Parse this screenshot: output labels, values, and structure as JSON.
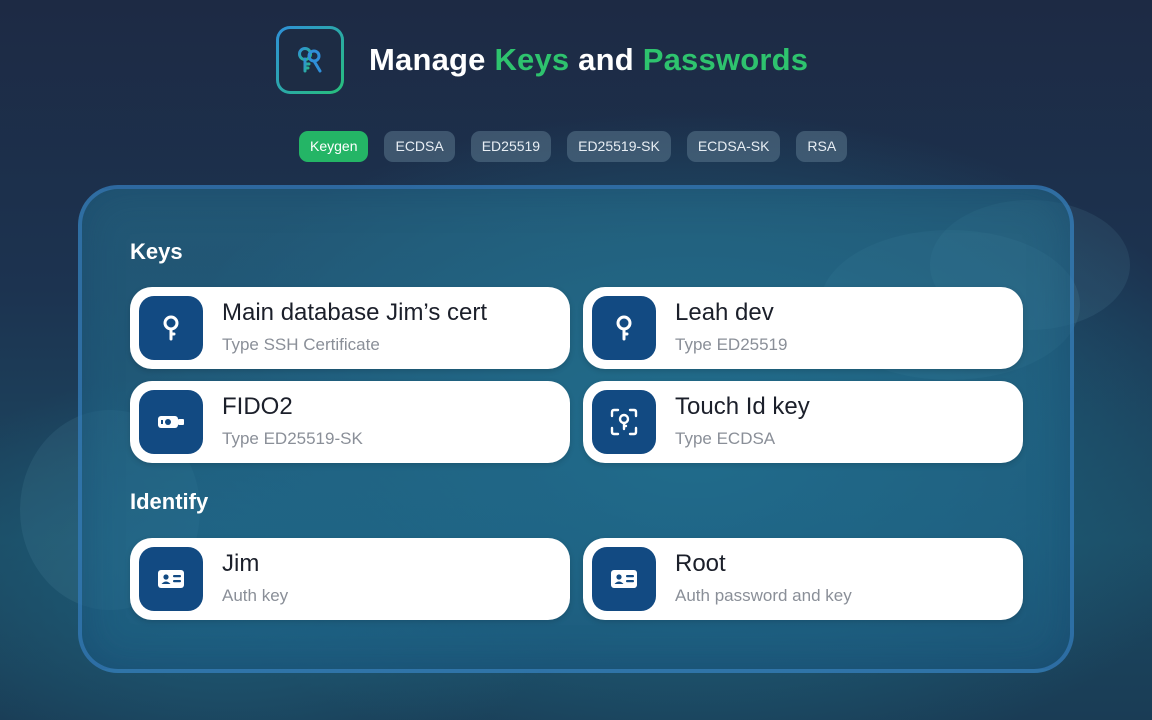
{
  "header": {
    "title_part1": "Manage ",
    "title_part2": "Keys",
    "title_part3": " and ",
    "title_part4": "Passwords",
    "logo_icon": "keys-logo-icon"
  },
  "tabs": [
    {
      "label": "Keygen",
      "active": true
    },
    {
      "label": "ECDSA",
      "active": false
    },
    {
      "label": "ED25519",
      "active": false
    },
    {
      "label": "ED25519-SK",
      "active": false
    },
    {
      "label": "ECDSA-SK",
      "active": false
    },
    {
      "label": "RSA",
      "active": false
    }
  ],
  "keys": {
    "title": "Keys",
    "items": [
      {
        "name": "Main database Jim’s cert",
        "type": "Type SSH Certificate",
        "icon": "key-icon"
      },
      {
        "name": "Leah dev",
        "type": "Type ED25519",
        "icon": "key-icon"
      },
      {
        "name": "FIDO2",
        "type": "Type ED25519-SK",
        "icon": "security-key-icon"
      },
      {
        "name": "Touch Id key",
        "type": "Type ECDSA",
        "icon": "touch-id-key-icon"
      }
    ]
  },
  "identify": {
    "title": "Identify",
    "items": [
      {
        "name": "Jim",
        "type": "Auth key",
        "icon": "id-card-icon"
      },
      {
        "name": "Root",
        "type": "Auth password and key",
        "icon": "id-card-icon"
      }
    ]
  },
  "colors": {
    "accent_green": "#2ec36e",
    "tab_active": "#24b566",
    "icon_tile": "#124a82"
  }
}
